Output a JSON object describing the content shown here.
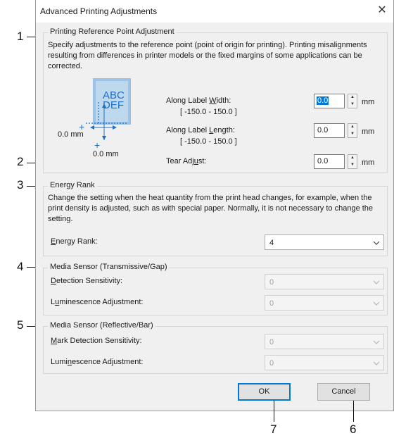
{
  "window": {
    "title": "Advanced Printing Adjustments",
    "close_icon": "close-icon"
  },
  "reference_group": {
    "title": "Printing Reference Point Adjustment",
    "description": "Specify adjustments to the reference point (point of origin for printing). Printing misalignments resulting from differences in printer models or the fixed margins of some applications can be corrected.",
    "preview": {
      "line1": "ABC",
      "line2": "DEF",
      "left_offset": "0.0 mm",
      "bottom_offset": "0.0 mm"
    },
    "width": {
      "label_prefix": "Along Label ",
      "label_key": "W",
      "label_suffix": "idth:",
      "range": "[ -150.0 - 150.0 ]",
      "value": "0.0",
      "unit": "mm"
    },
    "length": {
      "label_prefix": "Along Label ",
      "label_key": "L",
      "label_suffix": "ength:",
      "range": "[ -150.0 - 150.0 ]",
      "value": "0.0",
      "unit": "mm"
    },
    "tear": {
      "label_prefix": "Tear Adj",
      "label_key": "u",
      "label_suffix": "st:",
      "value": "0.0",
      "unit": "mm"
    }
  },
  "energy_group": {
    "title": "Energy Rank",
    "description": "Change the setting when the heat quantity from the print head changes, for example, when the print density is adjusted, such as with special paper. Normally, it is not necessary to change the setting.",
    "label_key": "E",
    "label_rest": "nergy Rank:",
    "value": "4"
  },
  "media_trans_group": {
    "title": "Media Sensor (Transmissive/Gap)",
    "detection": {
      "label_key": "D",
      "label_rest": "etection Sensitivity:",
      "value": "0"
    },
    "luminescence": {
      "label_pre": "L",
      "label_key": "u",
      "label_rest": "minescence Adjustment:",
      "value": "0"
    }
  },
  "media_refl_group": {
    "title": "Media Sensor (Reflective/Bar)",
    "mark": {
      "label_key": "M",
      "label_rest": "ark Detection Sensitivity:",
      "value": "0"
    },
    "luminescence": {
      "label_pre": "Lumi",
      "label_key": "n",
      "label_rest": "escence Adjustment:",
      "value": "0"
    }
  },
  "buttons": {
    "ok": "OK",
    "cancel": "Cancel"
  },
  "callouts": [
    "1",
    "2",
    "3",
    "4",
    "5",
    "6",
    "7"
  ],
  "colors": {
    "accent": "#0078d7",
    "preview_label": "#9cc3e5",
    "preview_blue": "#1f6fc5"
  }
}
